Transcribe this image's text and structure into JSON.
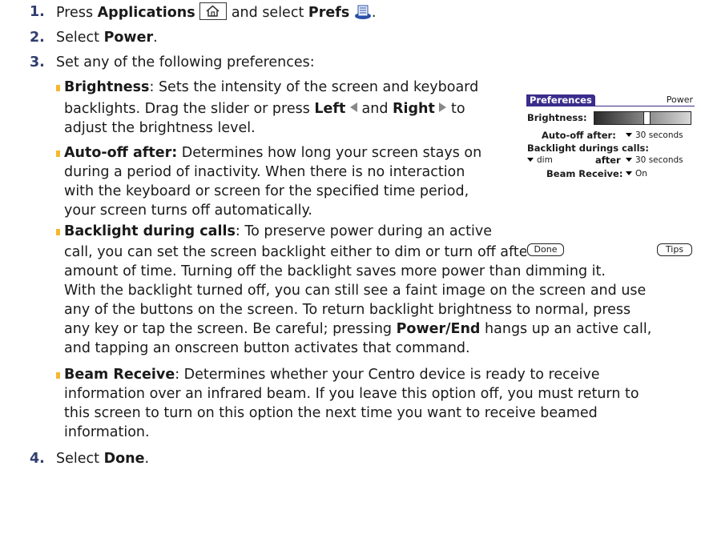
{
  "steps": {
    "s1": {
      "num": "1.",
      "a": "Press ",
      "b1": "Applications",
      "c": " and select ",
      "b2": "Prefs",
      "d": "."
    },
    "s2": {
      "num": "2.",
      "a": "Select ",
      "b1": "Power",
      "d": "."
    },
    "s3": {
      "num": "3.",
      "a": "Set any of the following preferences:"
    },
    "s4": {
      "num": "4.",
      "a": "Select ",
      "b1": "Done",
      "d": "."
    }
  },
  "brightness": {
    "term": "Brightness",
    "l1": ": Sets the intensity of the screen and keyboard",
    "l2": "backlights. Drag the slider or press ",
    "left": "Left",
    "and": " and ",
    "right": "Right",
    "to": " to",
    "l3": "adjust the brightness level."
  },
  "autooff": {
    "term": "Auto-off after:",
    "l1": " Determines how long your screen stays on",
    "l2": "during a period of inactivity. When there is no interaction",
    "l3": "with the keyboard or screen for the specified time period,",
    "l4": "your screen turns off automatically."
  },
  "backlight": {
    "term": "Backlight during calls",
    "l1": ": To preserve power during an active",
    "l2": "call, you can set the screen backlight either to dim or turn off after a specified",
    "l3": "amount of time. Turning off the backlight saves more power than dimming it.",
    "l4": "With the backlight turned off, you can still see a faint image on the screen and use",
    "l5": "any of the buttons on the screen. To return backlight brightness to normal, press",
    "l6a": "any key or tap the screen. Be careful; pressing ",
    "l6b": "Power/End",
    "l6c": " hangs up an active call,",
    "l7": "and tapping an onscreen button activates that command."
  },
  "beam": {
    "term": "Beam Receive",
    "l1": ": Determines whether your Centro device is ready to receive",
    "l2": "information over an infrared beam. If you leave this option off, you must return to",
    "l3": "this screen to turn on this option the next time you want to receive beamed",
    "l4": "information."
  },
  "palm": {
    "title": "Preferences",
    "panel": "Power",
    "brightness_label": "Brightness:",
    "brightness_level": 0.55,
    "autooff_label": "Auto-off after:",
    "autooff_value": "30 seconds",
    "backlight_label": "Backlight durings calls:",
    "backlight_mode": "dim",
    "after_label": "after",
    "backlight_after": "30 seconds",
    "beam_label": "Beam Receive:",
    "beam_value": "On",
    "done_button": "Done",
    "tips_button": "Tips"
  },
  "colors": {
    "step_number": "#2f3e6e",
    "bullet": "#f4b830",
    "palm_title": "#3a2d8c"
  },
  "icons": {
    "applications": "home-icon",
    "prefs": "prefs-icon"
  }
}
